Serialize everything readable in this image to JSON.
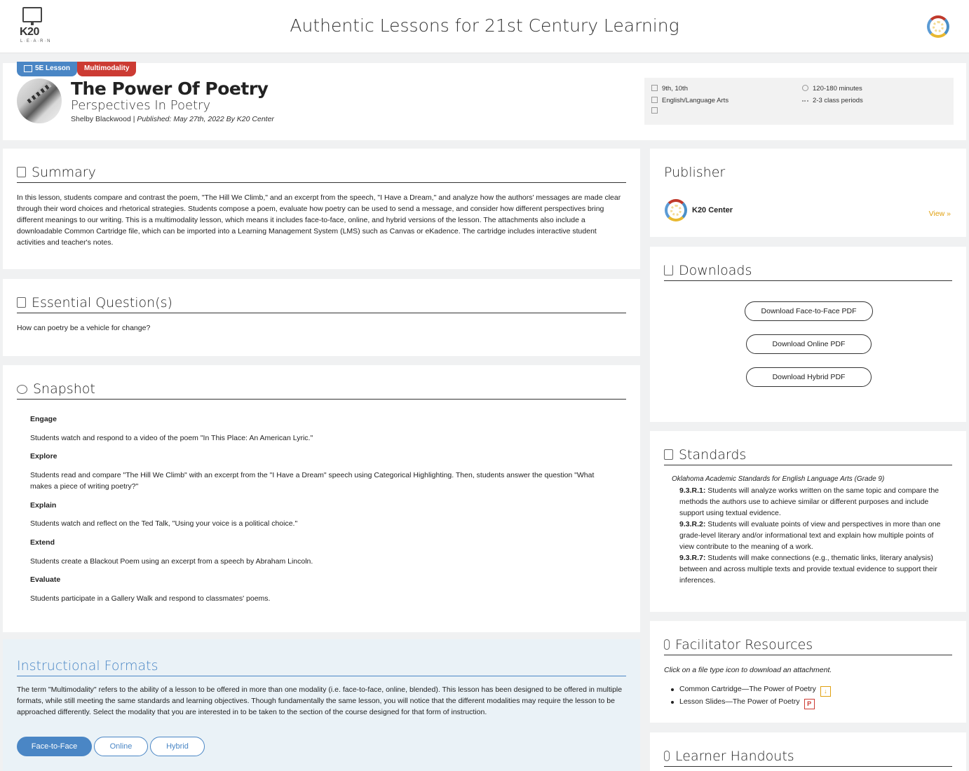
{
  "site": {
    "logo_text": "K20",
    "logo_sub": "L·E·A·R·N",
    "title": "Authentic Lessons for 21st Century Learning"
  },
  "lesson": {
    "badges": [
      "5E Lesson",
      "Multimodality"
    ],
    "title": "The Power Of Poetry",
    "subtitle": "Perspectives In Poetry",
    "author": "Shelby Blackwood",
    "published": "Published: May 27th, 2022 By K20 Center",
    "meta": {
      "grades": "9th, 10th",
      "subject": "English/Language Arts",
      "duration": "120-180 minutes",
      "periods": "2-3 class periods"
    }
  },
  "summary": {
    "heading": "Summary",
    "text": "In this lesson, students compare and contrast the poem, \"The Hill We Climb,\" and an excerpt from the speech, \"I Have a Dream,\" and analyze how the authors' messages are made clear through their word choices and rhetorical strategies. Students compose a poem, evaluate how poetry can be used to send a message, and consider how different perspectives bring different meanings to our writing. This is a multimodality lesson, which means it includes face-to-face, online, and hybrid versions of the lesson. The attachments also include a downloadable Common Cartridge file, which can be imported into a Learning Management System (LMS) such as Canvas or eKadence. The cartridge includes interactive student activities and teacher's notes."
  },
  "essential": {
    "heading": "Essential Question(s)",
    "text": "How can poetry be a vehicle for change?"
  },
  "snapshot": {
    "heading": "Snapshot",
    "phases": [
      {
        "name": "Engage",
        "text": "Students watch and respond to a video of the poem \"In This Place: An American Lyric.\""
      },
      {
        "name": "Explore",
        "text": "Students read and compare \"The Hill We Climb\" with an excerpt from the \"I Have a Dream\" speech using Categorical Highlighting. Then, students answer the question \"What makes a piece of writing poetry?\""
      },
      {
        "name": "Explain",
        "text": "Students watch and reflect on the Ted Talk, \"Using your voice is a political choice.\""
      },
      {
        "name": "Extend",
        "text": "Students create a Blackout Poem using an excerpt from a speech by Abraham Lincoln."
      },
      {
        "name": "Evaluate",
        "text": "Students participate in a Gallery Walk and respond to classmates' poems."
      }
    ]
  },
  "formats": {
    "heading": "Instructional Formats",
    "text": "The term \"Multimodality\" refers to the ability of a lesson to be offered in more than one modality (i.e. face-to-face, online, blended). This lesson has been designed to be offered in multiple formats, while still meeting the same standards and learning objectives. Though fundamentally the same lesson, you will notice that the different modalities may require the lesson to be approached differently. Select the modality that you are interested in to be taken to the section of the course designed for that form of instruction.",
    "buttons": [
      "Face-to-Face",
      "Online",
      "Hybrid"
    ]
  },
  "publisher": {
    "heading": "Publisher",
    "name": "K20 Center",
    "view_label": "View »"
  },
  "downloads": {
    "heading": "Downloads",
    "buttons": [
      "Download Face-to-Face PDF",
      "Download Online PDF",
      "Download Hybrid PDF"
    ]
  },
  "standards": {
    "heading": "Standards",
    "source": "Oklahoma Academic Standards for English Language Arts (Grade 9)",
    "items": [
      {
        "code": "9.3.R.1:",
        "text": " Students will analyze works written on the same topic and compare the methods the authors use to achieve similar or different purposes and include support using textual evidence."
      },
      {
        "code": "9.3.R.2:",
        "text": " Students will evaluate points of view and perspectives in more than one grade-level literary and/or informational text and explain how multiple points of view contribute to the meaning of a work."
      },
      {
        "code": "9.3.R.7:",
        "text": " Students will make connections (e.g., thematic links, literary analysis) between and across multiple texts and provide textual evidence to support their inferences."
      }
    ]
  },
  "facilitator": {
    "heading": "Facilitator Resources",
    "note": "Click on a file type icon to download an attachment.",
    "items": [
      "Common Cartridge—The Power of Poetry",
      "Lesson Slides—The Power of Poetry"
    ]
  },
  "learner": {
    "heading": "Learner Handouts"
  },
  "colors": {
    "accent": "#4a86c5",
    "badge_red": "#cc3b33",
    "link_gold": "#e0a010"
  }
}
